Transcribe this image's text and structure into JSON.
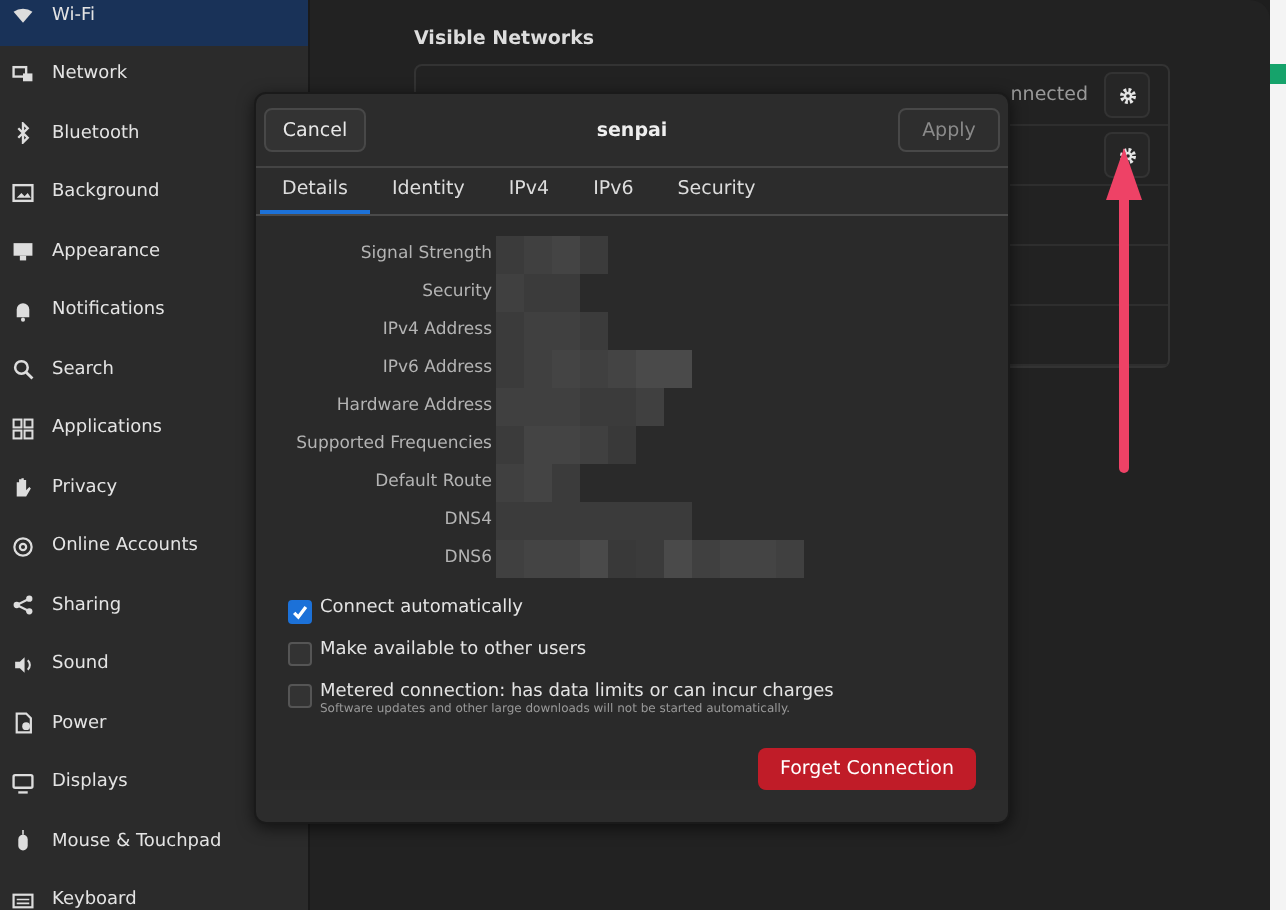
{
  "sidebar": {
    "items": [
      {
        "label": "Wi-Fi",
        "selected": true
      },
      {
        "label": "Network",
        "selected": false
      },
      {
        "label": "Bluetooth",
        "selected": false
      },
      {
        "label": "Background",
        "selected": false
      },
      {
        "label": "Appearance",
        "selected": false
      },
      {
        "label": "Notifications",
        "selected": false
      },
      {
        "label": "Search",
        "selected": false
      },
      {
        "label": "Applications",
        "selected": false
      },
      {
        "label": "Privacy",
        "selected": false
      },
      {
        "label": "Online Accounts",
        "selected": false
      },
      {
        "label": "Sharing",
        "selected": false
      },
      {
        "label": "Sound",
        "selected": false
      },
      {
        "label": "Power",
        "selected": false
      },
      {
        "label": "Displays",
        "selected": false
      },
      {
        "label": "Mouse & Touchpad",
        "selected": false
      },
      {
        "label": "Keyboard",
        "selected": false
      }
    ]
  },
  "visible_networks": {
    "title": "Visible Networks",
    "rows": [
      {
        "status": "nnected",
        "settings_button": true
      },
      {
        "settings_button": true
      },
      {
        "settings_button": false
      },
      {
        "settings_button": false
      },
      {
        "settings_button": false
      }
    ]
  },
  "dialog": {
    "title": "senpai",
    "cancel": "Cancel",
    "apply": {
      "label": "Apply",
      "disabled": true
    },
    "tabs": [
      {
        "label": "Details",
        "selected": true
      },
      {
        "label": "Identity",
        "selected": false
      },
      {
        "label": "IPv4",
        "selected": false
      },
      {
        "label": "IPv6",
        "selected": false
      },
      {
        "label": "Security",
        "selected": false
      }
    ],
    "details": [
      {
        "label": "Signal Strength",
        "value_hidden": true
      },
      {
        "label": "Security",
        "value_hidden": true
      },
      {
        "label": "IPv4 Address",
        "value_hidden": true
      },
      {
        "label": "IPv6 Address",
        "value_hidden": true
      },
      {
        "label": "Hardware Address",
        "value_hidden": true
      },
      {
        "label": "Supported Frequencies",
        "value_hidden": true
      },
      {
        "label": "Default Route",
        "value_hidden": true
      },
      {
        "label": "DNS4",
        "value_hidden": true
      },
      {
        "label": "DNS6",
        "value_hidden": true
      }
    ],
    "options": [
      {
        "label": "Connect automatically",
        "checked": true
      },
      {
        "label": "Make available to other users",
        "checked": false
      },
      {
        "label": "Metered connection: has data limits or can incur charges",
        "checked": false,
        "description": "Software updates and other large downloads will not be started automatically."
      }
    ],
    "forget": "Forget Connection"
  }
}
